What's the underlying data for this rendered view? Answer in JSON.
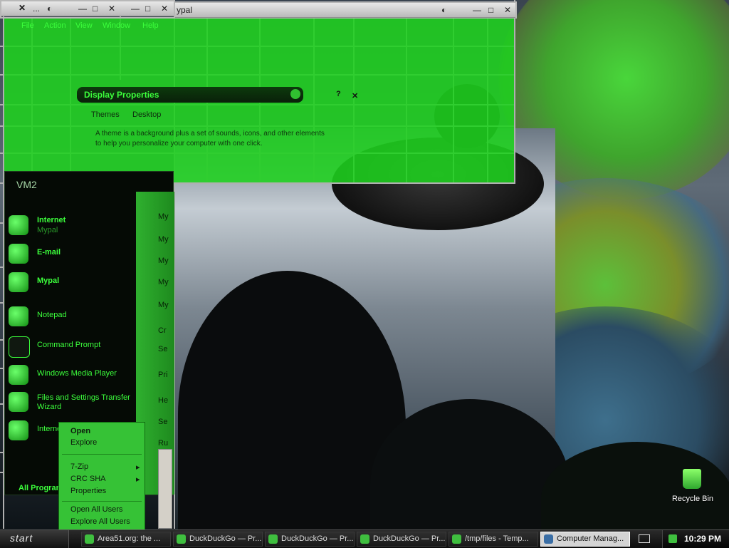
{
  "windows": {
    "back_window_title": "...",
    "mypal_window_title": "ypal",
    "menu_file": "File",
    "menu_action": "Action",
    "menu_view": "View",
    "menu_window": "Window",
    "menu_help": "Help",
    "display_properties_title": "Display Properties",
    "display_tab_themes": "Themes",
    "display_tab_desktop": "Desktop",
    "display_text_line1": "A theme is a background plus a set of sounds, icons, and other elements",
    "display_text_line2": "to help you personalize your computer with one click.",
    "vm_label": "VM2"
  },
  "start_menu": {
    "pinned": [
      {
        "label": "Internet",
        "sub": "Mypal"
      },
      {
        "label": "E-mail",
        "sub": ""
      },
      {
        "label": "Mypal",
        "sub": ""
      }
    ],
    "recent": [
      {
        "label": "Notepad"
      },
      {
        "label": "Command Prompt"
      },
      {
        "label": "Windows Media Player"
      },
      {
        "label": "Files and Settings Transfer Wizard"
      },
      {
        "label": "Internet"
      }
    ],
    "all_programs": "All Programs",
    "right_items": [
      "My",
      "My",
      "My",
      "My",
      "My",
      "Cr",
      "Se",
      "Pri",
      "He",
      "Se",
      "Ru"
    ]
  },
  "context_menu": {
    "items": [
      "Open",
      "Explore",
      "7-Zip",
      "CRC SHA",
      "Properties",
      "Open All Users",
      "Explore All Users"
    ]
  },
  "desktop": {
    "recycle_bin_label": "Recycle Bin"
  },
  "taskbar": {
    "start_label": "start",
    "buttons": [
      "Area51.org: the ...",
      "DuckDuckGo — Pr...",
      "DuckDuckGo — Pr...",
      "DuckDuckGo — Pr...",
      "/tmp/files - Temp...",
      "Computer Manag..."
    ],
    "clock": "10:29 PM"
  },
  "colors": {
    "accent_green": "#3cff3c",
    "taskbar_bg": "#111111"
  }
}
